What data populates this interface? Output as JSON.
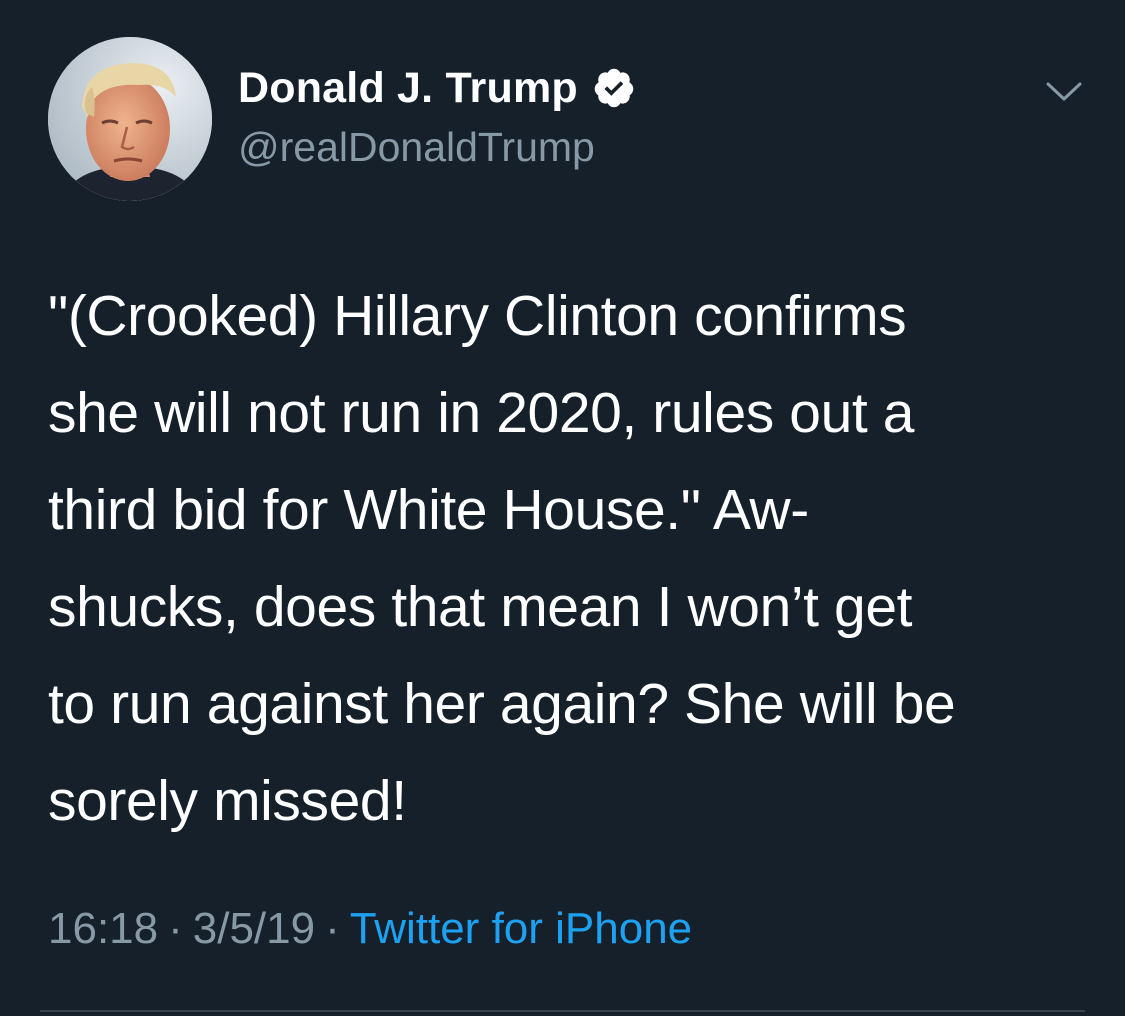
{
  "author": {
    "display_name": "Donald J. Trump",
    "handle": "@realDonaldTrump",
    "verified": true
  },
  "tweet": {
    "lines": [
      "\"(Crooked) Hillary Clinton confirms",
      "she will not run in 2020, rules out a",
      "third bid for White House.\" Aw-",
      "shucks, does that mean I won’t get",
      "to run against her again? She will be",
      "sorely missed!"
    ]
  },
  "meta": {
    "time": "16:18",
    "separator": "·",
    "date": "3/5/19",
    "source": "Twitter for iPhone"
  },
  "icons": {
    "avatar": "profile-photo",
    "verified": "verified-badge-icon",
    "menu": "chevron-down-icon"
  },
  "colors": {
    "background": "#15202b",
    "text": "#ffffff",
    "secondary": "#8899a6",
    "link": "#1da1f2"
  }
}
